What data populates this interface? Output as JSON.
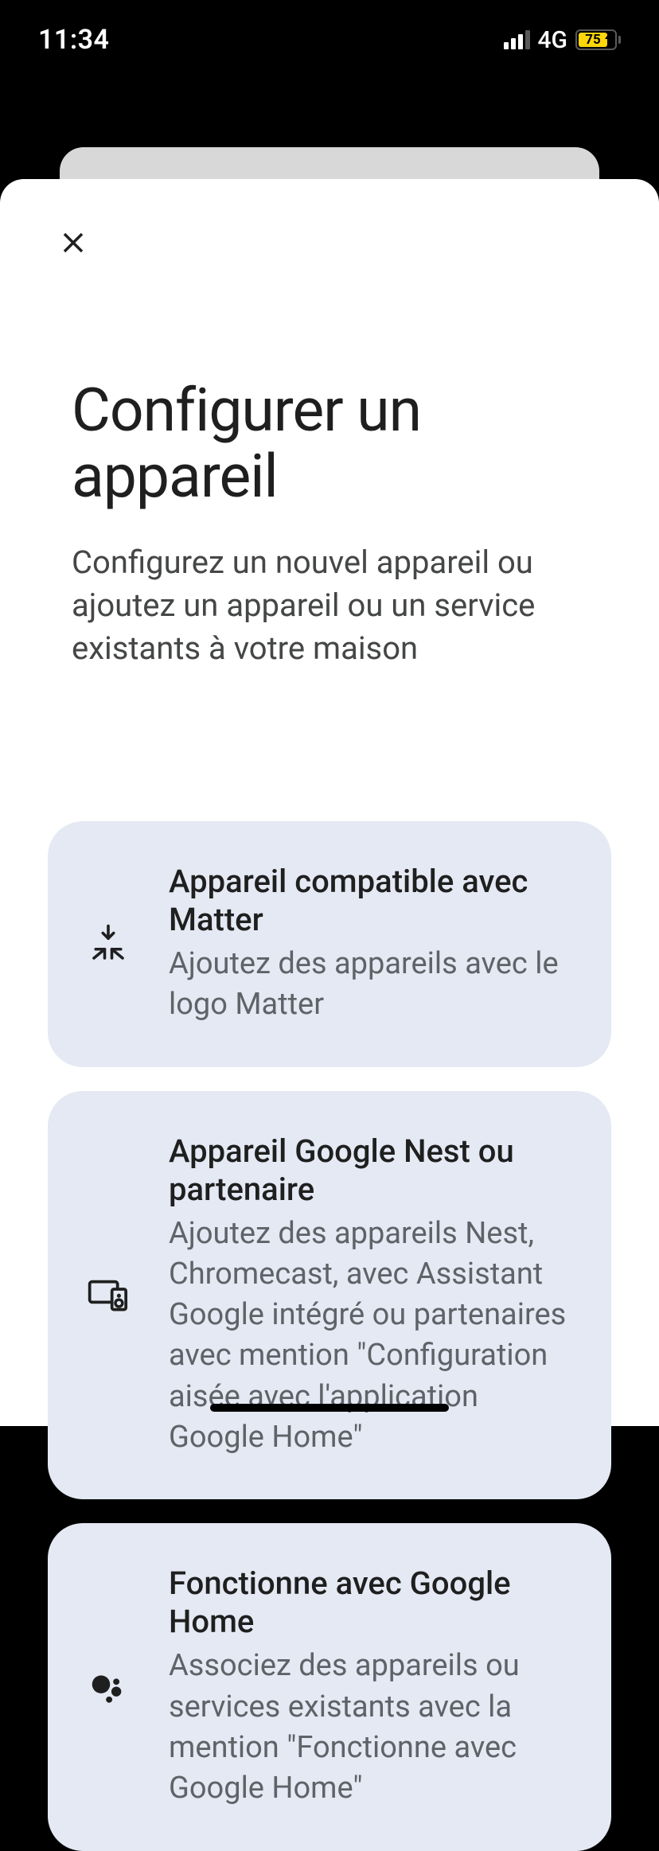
{
  "status": {
    "time": "11:34",
    "network": "4G",
    "battery_pct": "75"
  },
  "header": {
    "title": "Configurer un appareil",
    "subtitle": "Configurez un nouvel appareil ou ajoutez un appareil ou un service existants à votre maison"
  },
  "options": [
    {
      "title": "Appareil compatible avec Matter",
      "desc": "Ajoutez des appareils avec le logo Matter"
    },
    {
      "title": "Appareil Google Nest ou partenaire",
      "desc": "Ajoutez des appareils Nest, Chromecast, avec Assistant Google intégré ou partenaires avec mention \"Configuration aisée avec l'application Google Home\""
    },
    {
      "title": "Fonctionne avec Google Home",
      "desc": "Associez des appareils ou services existants avec la mention \"Fonctionne avec Google Home\""
    }
  ]
}
